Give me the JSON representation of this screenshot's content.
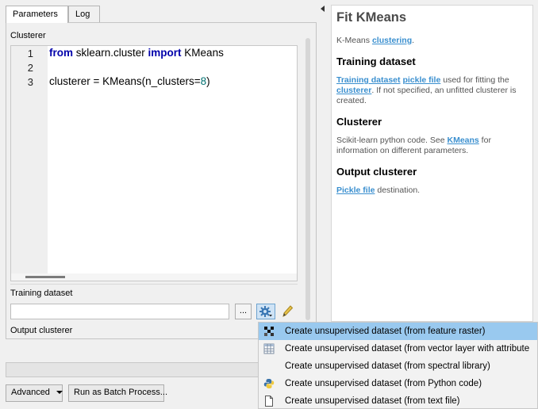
{
  "tabs": {
    "parameters": "Parameters",
    "log": "Log"
  },
  "clusterer": {
    "label": "Clusterer",
    "line_numbers": [
      "1",
      "2",
      "3"
    ],
    "line1": {
      "kw1": "from",
      "module": " sklearn.cluster ",
      "kw2": "import",
      "name": " KMeans"
    },
    "line3": {
      "pre": "clusterer = KMeans(n_clusters=",
      "num": "8",
      "post": ")"
    }
  },
  "training_dataset": {
    "label": "Training dataset",
    "value": "",
    "browse_label": "..."
  },
  "output_clusterer": {
    "label": "Output clusterer"
  },
  "buttons": {
    "advanced": "Advanced",
    "batch": "Run as Batch Process..."
  },
  "help": {
    "title": "Fit KMeans",
    "intro_text": "K-Means ",
    "intro_link": "clustering",
    "intro_end": ".",
    "training_heading": "Training dataset",
    "training_link1": "Training dataset",
    "training_link2": "pickle file",
    "training_text1": " used for fitting the ",
    "training_link3": "clusterer",
    "training_text2": ". If not specified, an unfitted clusterer is created.",
    "clusterer_heading": "Clusterer",
    "clusterer_text1": "Scikit-learn python code. See ",
    "clusterer_link": "KMeans",
    "clusterer_text2": " for information on different parameters.",
    "output_heading": "Output clusterer",
    "output_link": "Pickle file",
    "output_text": " destination."
  },
  "menu": {
    "items": [
      {
        "label": "Create unsupervised dataset (from feature raster)",
        "icon": "raster-icon",
        "highlighted": true
      },
      {
        "label": "Create unsupervised dataset (from vector layer with attribute",
        "icon": "table-icon",
        "highlighted": false
      },
      {
        "label": "Create unsupervised dataset (from spectral library)",
        "icon": "",
        "highlighted": false
      },
      {
        "label": "Create unsupervised dataset (from Python code)",
        "icon": "python-icon",
        "highlighted": false
      },
      {
        "label": "Create unsupervised dataset (from text file)",
        "icon": "file-icon",
        "highlighted": false
      }
    ]
  },
  "colors": {
    "link": "#3a8fcf",
    "menu_highlight": "#99c9ef",
    "keyword": "#0000aa"
  }
}
